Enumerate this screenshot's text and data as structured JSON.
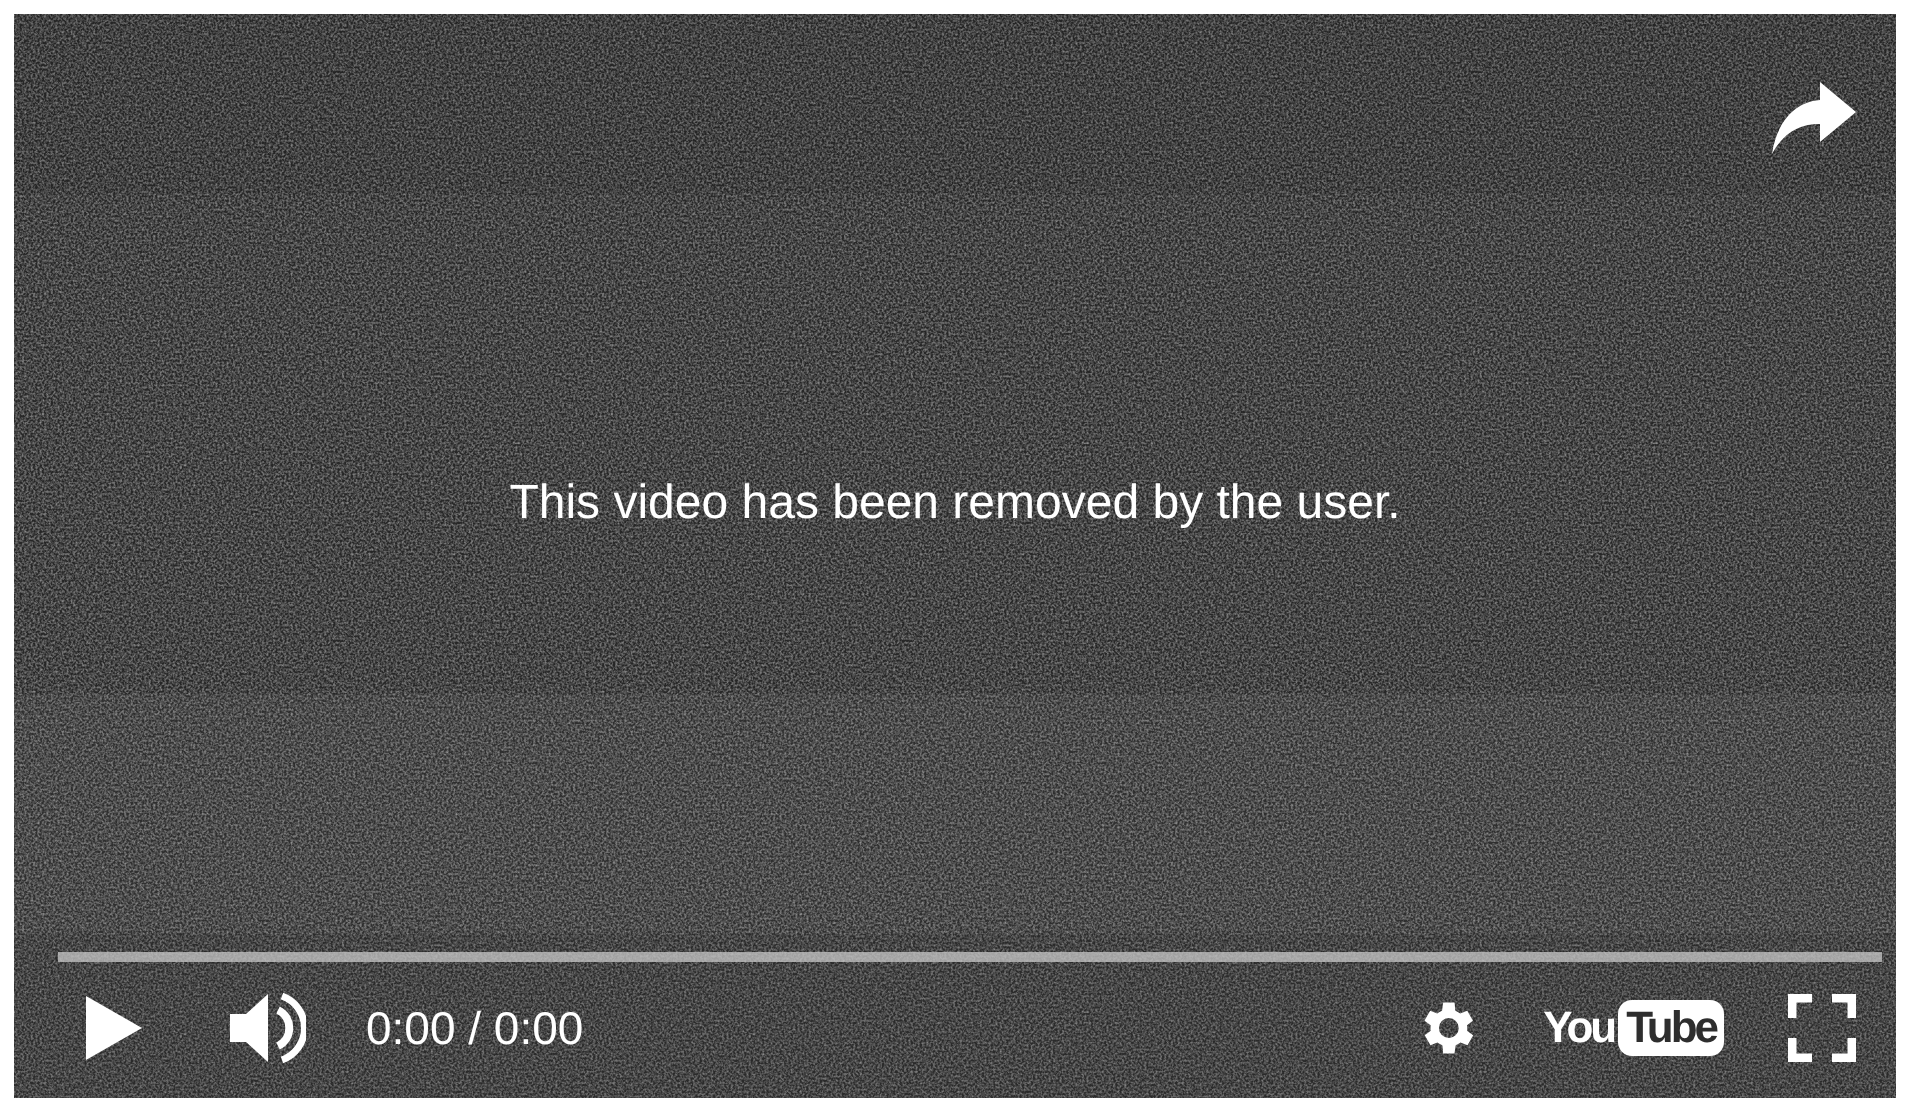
{
  "player": {
    "message": "This video has been removed by the user.",
    "progress": {
      "level": 0
    },
    "time": "0:00 / 0:00",
    "logo": {
      "left": "You",
      "right": "Tube"
    }
  }
}
